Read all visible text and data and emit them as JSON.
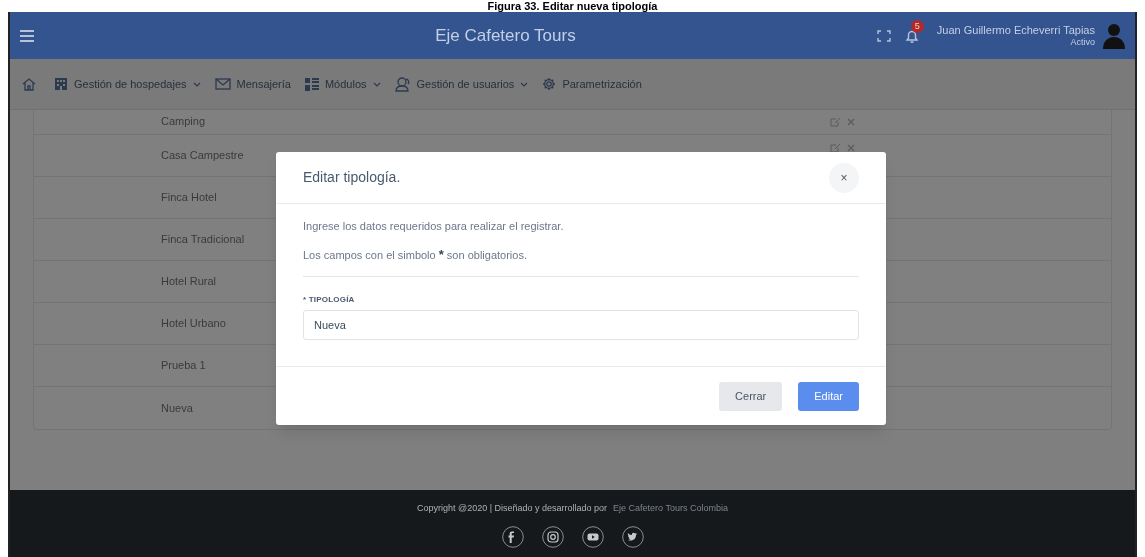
{
  "caption": "Figura 33. Editar nueva tipología",
  "header": {
    "title": "Eje Cafetero Tours",
    "notification_count": "5",
    "user_name": "Juan Guillermo Echeverri Tapias",
    "user_status": "Activo"
  },
  "nav": [
    {
      "label": "Gestión de hospedajes",
      "dropdown": true
    },
    {
      "label": "Mensajería",
      "dropdown": false
    },
    {
      "label": "Módulos",
      "dropdown": true
    },
    {
      "label": "Gestión de usuarios",
      "dropdown": true
    },
    {
      "label": "Parametrización",
      "dropdown": false
    }
  ],
  "table": {
    "rows": [
      {
        "name": "Camping",
        "actions_shown": true
      },
      {
        "name": "Casa Campestre",
        "actions_shown": true
      },
      {
        "name": "Finca Hotel",
        "actions_shown": false
      },
      {
        "name": "Finca Tradicional",
        "actions_shown": false
      },
      {
        "name": "Hotel Rural",
        "actions_shown": false
      },
      {
        "name": "Hotel Urbano",
        "actions_shown": false
      },
      {
        "name": "Prueba 1",
        "actions_shown": false
      },
      {
        "name": "Nueva",
        "actions_shown": false
      }
    ]
  },
  "modal": {
    "title": "Editar tipología.",
    "close": "×",
    "intro": "Ingrese los datos requeridos para realizar el registrar.",
    "note_parts": [
      "Los campos con el simbolo ",
      "*",
      " son obligatorios."
    ],
    "field": {
      "label": "* TIPOLOGÍA",
      "value": "Nueva"
    },
    "buttons": [
      {
        "label": "Cerrar",
        "kind": "secondary"
      },
      {
        "label": "Editar",
        "kind": "primary"
      }
    ]
  },
  "footer": {
    "text": "Copyright @2020 | Diseñado y desarrollado por",
    "link": "Eje Cafetero Tours Colombia"
  }
}
